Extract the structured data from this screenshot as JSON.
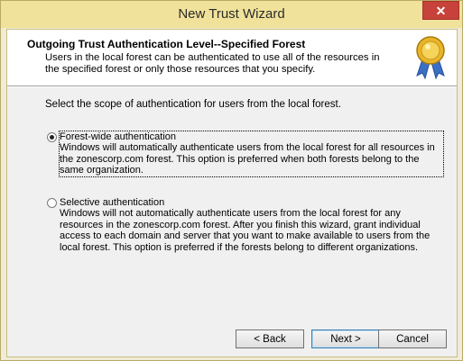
{
  "window": {
    "title": "New Trust Wizard",
    "close_glyph": "✕"
  },
  "header": {
    "title": "Outgoing Trust Authentication Level--Specified Forest",
    "description": "Users in the local forest can be authenticated to use all of the resources in the specified forest or only those resources that you specify.",
    "icon": "certificate-ribbon-icon"
  },
  "prompt": "Select the scope of authentication for users from the local forest.",
  "options": [
    {
      "label": "Forest-wide authentication",
      "description": "Windows will automatically authenticate users from the local forest for all resources in the zonescorp.com forest. This option is preferred when both forests belong to the same organization.",
      "selected": true
    },
    {
      "label": "Selective authentication",
      "description": "Windows will not automatically authenticate users from the local forest for any resources in the zonescorp.com forest. After you finish this wizard, grant individual access to each domain and server that you want to make available to users from the local forest. This option is preferred if the forests belong to different organizations.",
      "selected": false
    }
  ],
  "buttons": {
    "back": "< Back",
    "next": "Next >",
    "cancel": "Cancel"
  }
}
